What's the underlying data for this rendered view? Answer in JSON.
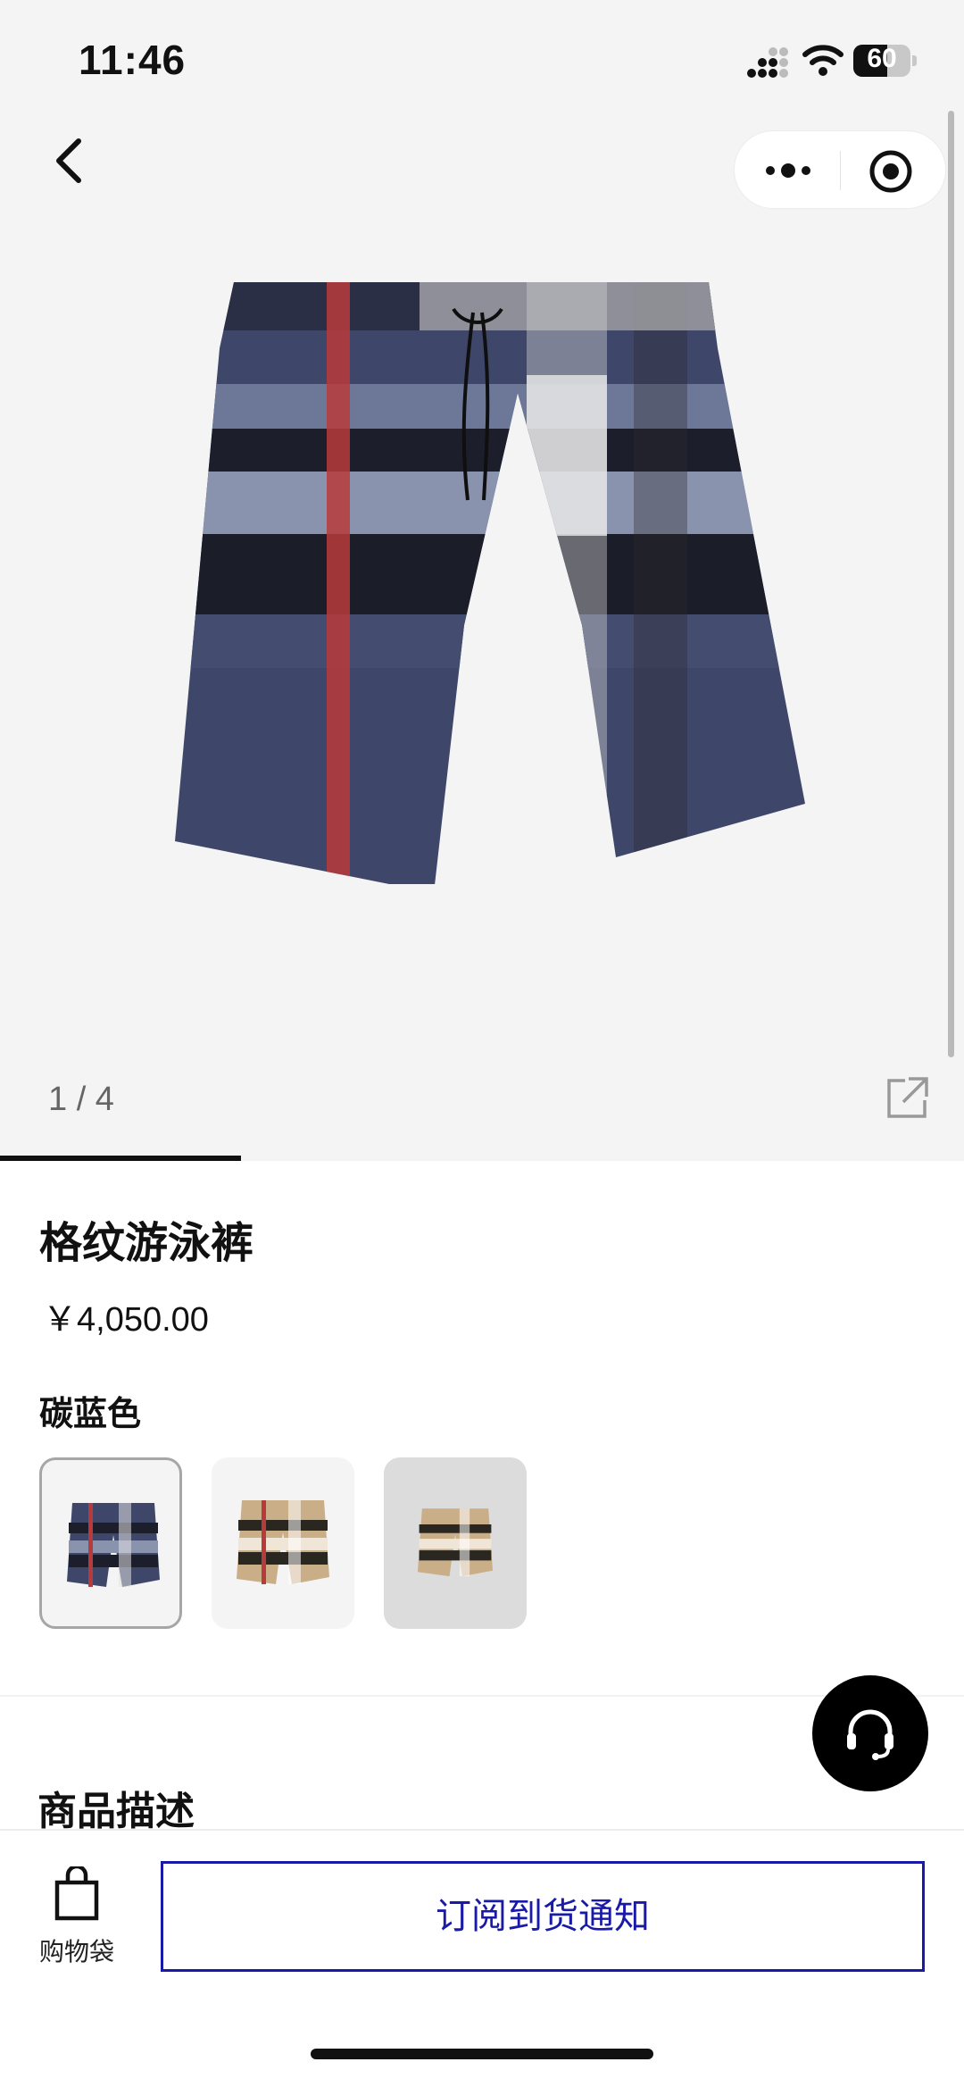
{
  "status_bar": {
    "time": "11:46",
    "battery": "60",
    "battery_level": 0.6
  },
  "gallery": {
    "counter": "1 / 4",
    "image_index": 1,
    "image_count": 4
  },
  "product": {
    "title": "格纹游泳裤",
    "price": "￥4,050.00",
    "color_name": "碳蓝色"
  },
  "swatches": [
    {
      "name": "carbon-blue",
      "selected": true
    },
    {
      "name": "archive-beige",
      "selected": false
    },
    {
      "name": "archive-beige-small",
      "selected": false
    }
  ],
  "sections": {
    "description_heading": "商品描述"
  },
  "bottom_bar": {
    "bag_label": "购物袋",
    "subscribe_label": "订阅到货通知"
  },
  "icons": {
    "back": "chevron-left-icon",
    "more": "more-dots-icon",
    "close_miniprogram": "target-icon",
    "share": "share-external-icon",
    "support": "headset-icon",
    "bag": "shopping-bag-icon"
  },
  "colors": {
    "accent": "#1a1aa8",
    "background": "#f4f4f4",
    "text": "#111111"
  }
}
